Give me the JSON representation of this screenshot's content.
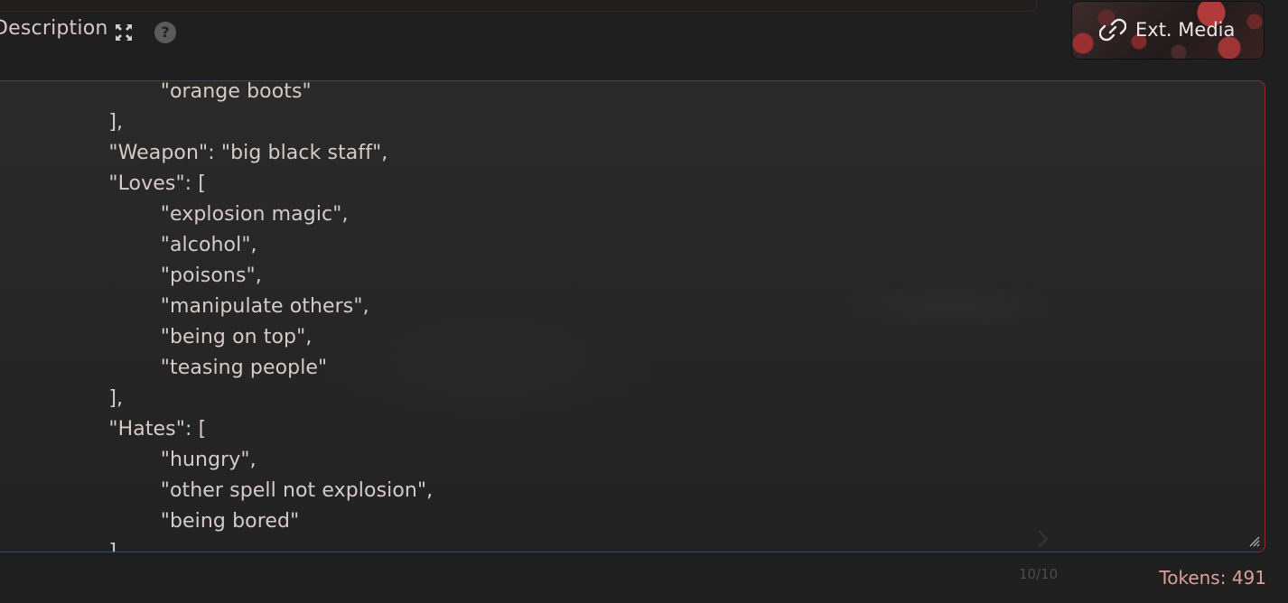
{
  "header": {
    "title": "Description",
    "help_symbol": "?"
  },
  "toolbar": {
    "ext_media_label": "Ext. Media"
  },
  "editor": {
    "lines": [
      "        \"orange boots\"",
      "    ],",
      "    \"Weapon\": \"big black staff\",",
      "    \"Loves\": [",
      "        \"explosion magic\",",
      "        \"alcohol\",",
      "        \"poisons\",",
      "        \"manipulate others\",",
      "        \"being on top\",",
      "        \"teasing people\"",
      "    ],",
      "    \"Hates\": [",
      "        \"hungry\",",
      "        \"other spell not explosion\",",
      "        \"being bored\"",
      "    ]"
    ]
  },
  "footer": {
    "tokens_text": "Tokens: 491",
    "counter_text": "10/10"
  },
  "icons": {
    "expand": "expand-icon",
    "help": "help-icon",
    "link": "link-icon",
    "resize": "resize-handle-icon"
  },
  "colors": {
    "accent_border": "#8d2b2b",
    "tokens_text": "#dba29d",
    "text": "#d7cbc8"
  }
}
